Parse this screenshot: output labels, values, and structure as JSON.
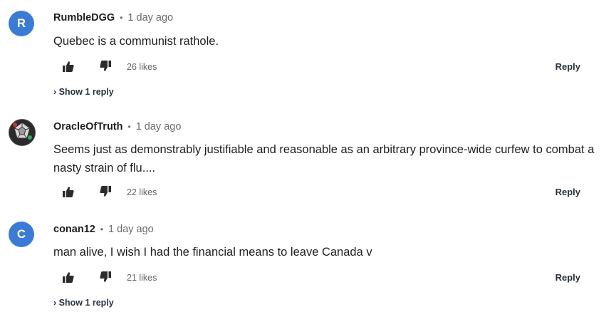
{
  "comments": [
    {
      "avatar_letter": "R",
      "avatar_color": "#3b7bd6",
      "username": "RumbleDGG",
      "separator": "•",
      "time": "1 day ago",
      "text": "Quebec is a communist rathole.",
      "likes": "26 likes",
      "reply_label": "Reply",
      "show_replies": "› Show 1 reply"
    },
    {
      "avatar_icon": "dodecahedron-avatar-icon",
      "username": "OracleOfTruth",
      "separator": "•",
      "time": "1 day ago",
      "text": "Seems just as demonstrably justifiable and reasonable as an arbitrary province-wide curfew to combat a nasty strain of flu....",
      "likes": "22 likes",
      "reply_label": "Reply"
    },
    {
      "avatar_letter": "C",
      "avatar_color": "#3b7bd6",
      "username": "conan12",
      "separator": "•",
      "time": "1 day ago",
      "text": "man alive, I wish I had the financial means to leave Canada v",
      "likes": "21 likes",
      "reply_label": "Reply",
      "show_replies": "› Show 1 reply"
    }
  ],
  "icons": {
    "like": "thumbs-up-icon",
    "dislike": "thumbs-down-icon"
  }
}
